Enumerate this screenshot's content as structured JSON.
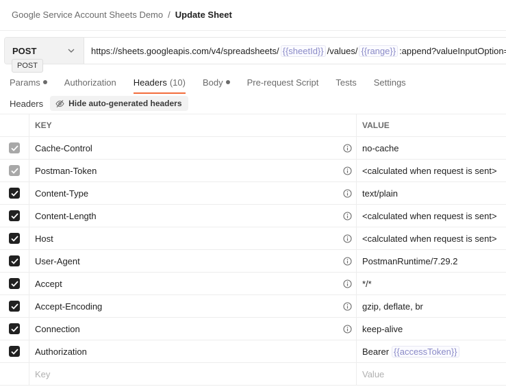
{
  "breadcrumb": {
    "parent": "Google Service Account Sheets Demo",
    "separator": "/",
    "current": "Update Sheet"
  },
  "request": {
    "method": "POST",
    "method_tooltip": "POST",
    "url_parts": {
      "p1": "https://sheets.googleapis.com/v4/spreadsheets/",
      "v1": "{{sheetId}}",
      "p2": "/values/",
      "v2": "{{range}}",
      "p3": ":append?valueInputOption=USER_ENTERED"
    }
  },
  "tabs": [
    {
      "label": "Params",
      "dot": true
    },
    {
      "label": "Authorization"
    },
    {
      "label": "Headers",
      "count": "(10)",
      "active": true
    },
    {
      "label": "Body",
      "dot": true
    },
    {
      "label": "Pre-request Script"
    },
    {
      "label": "Tests"
    },
    {
      "label": "Settings"
    }
  ],
  "headers_section": {
    "label": "Headers",
    "hide_button": "Hide auto-generated headers"
  },
  "table": {
    "columns": {
      "key": "KEY",
      "value": "VALUE"
    },
    "rows": [
      {
        "key": "Cache-Control",
        "value": "no-cache",
        "state": "disabled",
        "info": true
      },
      {
        "key": "Postman-Token",
        "value": "<calculated when request is sent>",
        "state": "disabled",
        "info": true
      },
      {
        "key": "Content-Type",
        "value": "text/plain",
        "state": "on",
        "info": true
      },
      {
        "key": "Content-Length",
        "value": "<calculated when request is sent>",
        "state": "on",
        "info": true
      },
      {
        "key": "Host",
        "value": "<calculated when request is sent>",
        "state": "on",
        "info": true
      },
      {
        "key": "User-Agent",
        "value": "PostmanRuntime/7.29.2",
        "state": "on",
        "info": true
      },
      {
        "key": "Accept",
        "value": "*/*",
        "state": "on",
        "info": true
      },
      {
        "key": "Accept-Encoding",
        "value": "gzip, deflate, br",
        "state": "on",
        "info": true
      },
      {
        "key": "Connection",
        "value": "keep-alive",
        "state": "on",
        "info": true
      },
      {
        "key": "Authorization",
        "value_prefix": "Bearer",
        "value_var": "{{accessToken}}",
        "state": "on",
        "info": false
      }
    ],
    "placeholder": {
      "key": "Key",
      "value": "Value"
    }
  },
  "colors": {
    "accent": "#f26b3a",
    "variable": "#8a8ac7",
    "checkbox_on": "#212121",
    "checkbox_disabled": "#a8a8a8"
  },
  "icons": {
    "method_dropdown": "chevron-down-icon",
    "hide_headers": "eye-off-icon",
    "row_info": "info-icon",
    "checkbox": "checkmark-icon"
  }
}
